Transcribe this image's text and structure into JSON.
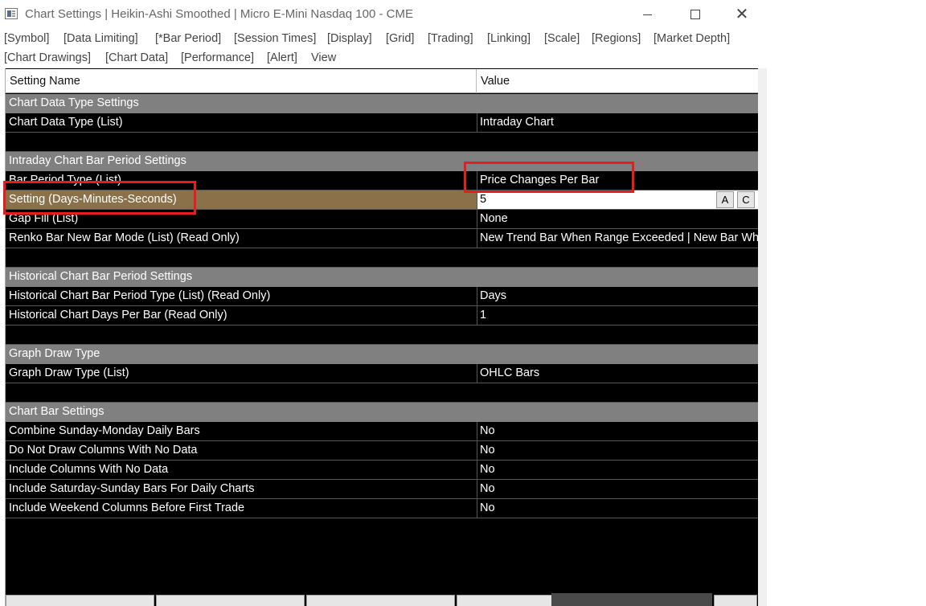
{
  "window": {
    "title": "Chart Settings | Heikin-Ashi Smoothed | Micro E-Mini Nasdaq 100 - CME",
    "min_icon": "minimize-icon",
    "max_icon": "maximize-icon",
    "close_icon": "close-icon"
  },
  "menu": {
    "row1": [
      "[Symbol]",
      "[Data Limiting]",
      "[*Bar Period]",
      "[Session Times]",
      "[Display]",
      "[Grid]",
      "[Trading]",
      "[Linking]",
      "[Scale]",
      "[Regions]",
      "[Market Depth]"
    ],
    "row2": [
      "[Chart Drawings]",
      "[Chart Data]",
      "[Performance]",
      "[Alert]",
      "View"
    ]
  },
  "grid": {
    "header": {
      "name": "Setting Name",
      "value": "Value"
    },
    "rows": [
      {
        "type": "section",
        "name": "Chart Data Type Settings"
      },
      {
        "type": "item",
        "name": "Chart Data Type (List)",
        "value": "Intraday Chart"
      },
      {
        "type": "blank"
      },
      {
        "type": "section",
        "name": "Intraday Chart Bar Period Settings"
      },
      {
        "type": "item",
        "name": "Bar Period Type (List)",
        "value": "Price Changes Per Bar"
      },
      {
        "type": "selected",
        "name": "Setting (Days-Minutes-Seconds)",
        "value": "5"
      },
      {
        "type": "item",
        "name": "Gap Fill (List)",
        "value": "None"
      },
      {
        "type": "item",
        "name": "Renko Bar New Bar Mode (List) (Read Only)",
        "value": "New Trend Bar When Range Exceeded | New Bar When"
      },
      {
        "type": "blank"
      },
      {
        "type": "section",
        "name": "Historical Chart Bar Period Settings"
      },
      {
        "type": "item",
        "name": "Historical Chart Bar Period Type (List) (Read Only)",
        "value": "Days"
      },
      {
        "type": "item",
        "name": "Historical Chart Days Per Bar (Read Only)",
        "value": "1"
      },
      {
        "type": "blank"
      },
      {
        "type": "section",
        "name": "Graph Draw Type"
      },
      {
        "type": "item",
        "name": "Graph Draw Type (List)",
        "value": "OHLC Bars"
      },
      {
        "type": "blank"
      },
      {
        "type": "section",
        "name": "Chart Bar Settings"
      },
      {
        "type": "item",
        "name": "Combine Sunday-Monday Daily Bars",
        "value": "No"
      },
      {
        "type": "item",
        "name": "Do Not Draw Columns With No Data",
        "value": "No"
      },
      {
        "type": "item",
        "name": "Include Columns With No Data",
        "value": "No"
      },
      {
        "type": "item",
        "name": "Include Saturday-Sunday Bars For Daily Charts",
        "value": "No"
      },
      {
        "type": "item",
        "name": "Include Weekend Columns Before First Trade",
        "value": "No"
      }
    ],
    "edit_buttons": [
      "A",
      "C"
    ]
  },
  "colors": {
    "grid_bg": "#000000",
    "section_bg": "#808080",
    "selected_bg": "#8a7149",
    "annotation": "#e41e1e"
  }
}
